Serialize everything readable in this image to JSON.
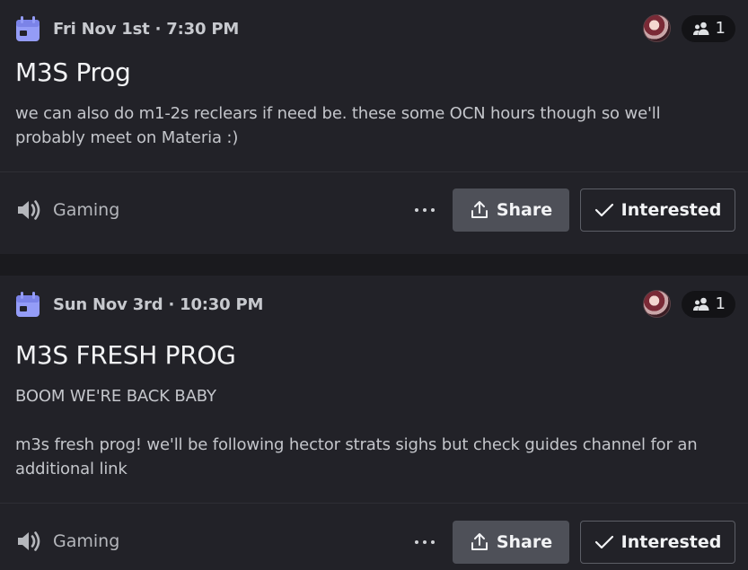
{
  "events": [
    {
      "date": "Fri Nov 1st · 7:30 PM",
      "title": "M3S Prog",
      "description": "we can also do m1-2s reclears if need be. these some OCN hours though so we'll probably meet on Materia :)",
      "interested_count": "1",
      "channel": "Gaming",
      "share_label": "Share",
      "interested_label": "Interested"
    },
    {
      "date": "Sun Nov 3rd · 10:30 PM",
      "title": "M3S FRESH PROG",
      "description_lines": [
        "BOOM WE'RE BACK BABY",
        "m3s fresh prog! we'll be following hector strats sighs but check guides channel for an additional link"
      ],
      "interested_count": "1",
      "channel": "Gaming",
      "share_label": "Share",
      "interested_label": "Interested"
    }
  ],
  "colors": {
    "calendar_icon": "#949cf7",
    "share_button_bg": "#4e5058",
    "card_bg": "#222228"
  },
  "icons": [
    "calendar-icon",
    "users-icon",
    "speaker-icon",
    "more-dots-icon",
    "share-icon",
    "checkmark-icon"
  ]
}
